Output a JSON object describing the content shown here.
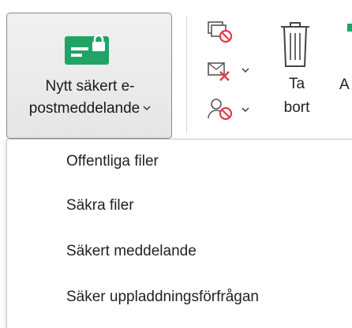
{
  "ribbon": {
    "new_secure_button": {
      "line1": "Nytt säkert e-",
      "line2": "postmeddelande"
    },
    "delete_button": {
      "line1": "Ta",
      "line2": "bort"
    },
    "truncated_label": "A"
  },
  "dropdown": {
    "items": [
      "Offentliga filer",
      "Säkra filer",
      "Säkert meddelande",
      "Säker uppladdningsförfrågan"
    ]
  },
  "colors": {
    "icon_green": "#21a366",
    "icon_red": "#e8364a",
    "icon_grey": "#555555"
  }
}
